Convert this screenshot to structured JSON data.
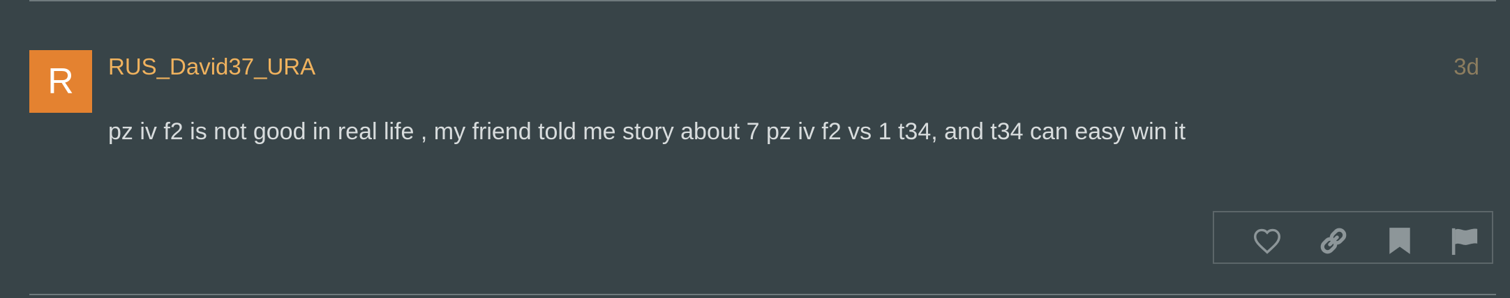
{
  "post": {
    "avatar_letter": "R",
    "avatar_color": "#e48230",
    "username": "RUS_David37_URA",
    "username_color": "#f0b25e",
    "date": "3d",
    "body": "pz iv f2 is not good in real life , my friend told me story about 7 pz iv f2 vs 1 t34, and t34 can easy win it"
  },
  "actions": [
    {
      "icon": "heart-icon"
    },
    {
      "icon": "link-icon"
    },
    {
      "icon": "bookmark-icon"
    },
    {
      "icon": "flag-icon"
    }
  ],
  "colors": {
    "background": "#384448",
    "icon": "#8d9699",
    "divider": "#6f7a7d"
  }
}
